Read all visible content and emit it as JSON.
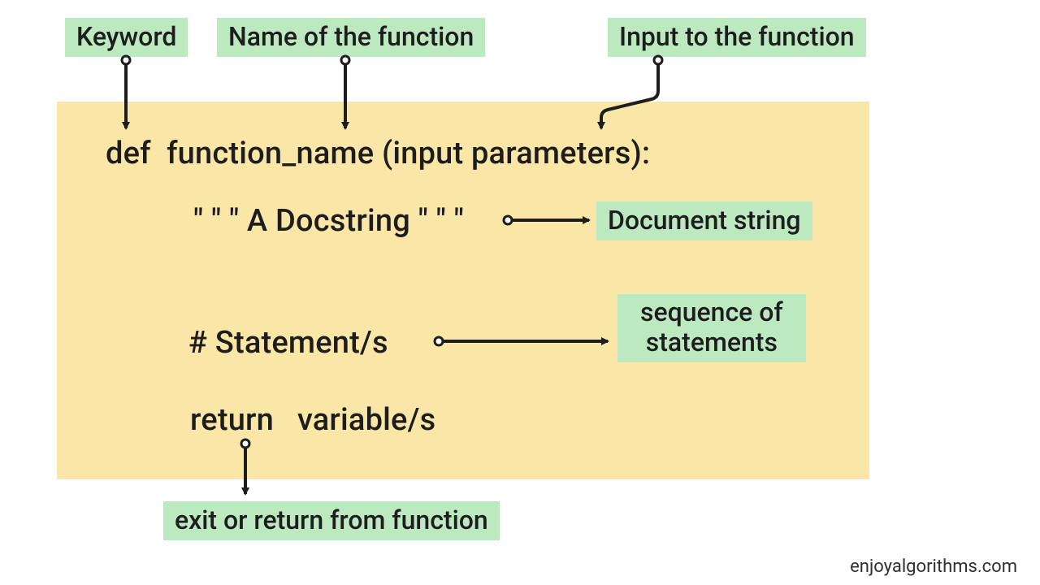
{
  "labels": {
    "keyword": "Keyword",
    "function_name": "Name of the function",
    "input": "Input to the function",
    "document_string": "Document string",
    "statements_l1": "sequence of",
    "statements_l2": "statements",
    "return": "exit or return from function"
  },
  "code": {
    "signature": "def  function_name (input parameters):",
    "docstring": "\" \" \" A Docstring \" \" \"",
    "stmt": "# Statement/s",
    "ret": "return   variable/s"
  },
  "footer": "enjoyalgorithms.com"
}
